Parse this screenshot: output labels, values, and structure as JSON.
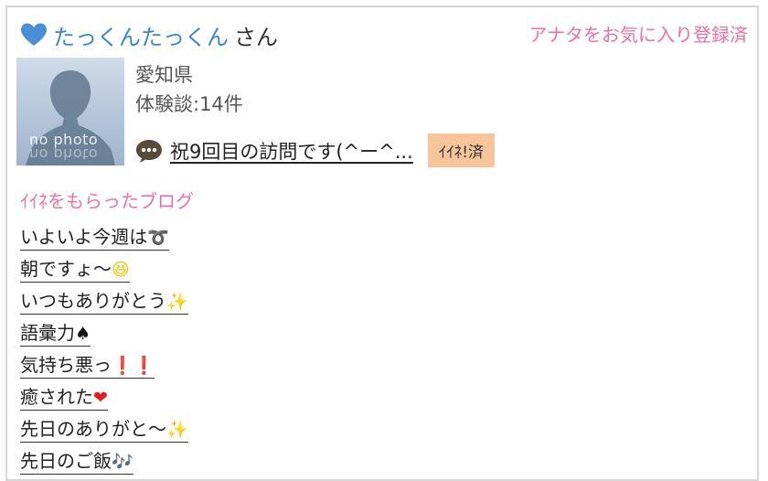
{
  "header": {
    "user_name": "たっくんたっくん",
    "honorific": "さん",
    "fav_status": "アナタをお気に入り登録済"
  },
  "avatar": {
    "placeholder_text": "no photo"
  },
  "profile": {
    "prefecture": "愛知県",
    "experience_count": "体験談:14件"
  },
  "message": {
    "text": "祝9回目の訪問です(^ー^...",
    "like_badge": "ｲｲﾈ!済"
  },
  "blog_section": {
    "title": "ｲｲﾈをもらったブログ",
    "items": [
      {
        "text": "いよいよ今週は",
        "emoji": "➰"
      },
      {
        "text": "朝ですょ〜",
        "emoji": "😆"
      },
      {
        "text": "いつもありがとう",
        "emoji": "✨"
      },
      {
        "text": "語彙力",
        "emoji": "♠"
      },
      {
        "text": "気持ち悪っ",
        "emoji": "❗❗"
      },
      {
        "text": "癒された",
        "emoji": "❤"
      },
      {
        "text": "先日のありがと〜",
        "emoji": "✨"
      },
      {
        "text": "先日のご飯",
        "emoji": "🎶"
      }
    ]
  },
  "colors": {
    "accent_blue": "#3b87c6",
    "accent_pink": "#ee6fa8",
    "badge_bg": "#f8c59b"
  }
}
